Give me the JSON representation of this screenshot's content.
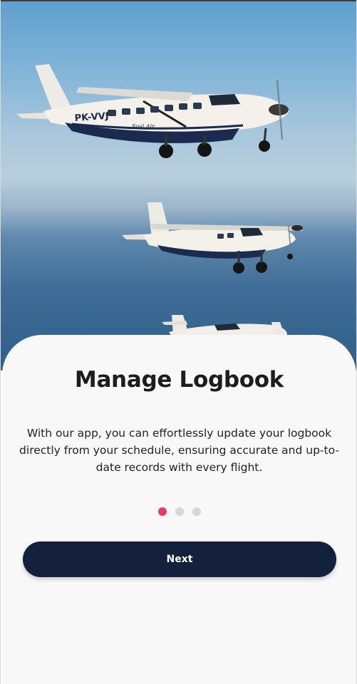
{
  "onboarding": {
    "title": "Manage Logbook",
    "description": "With our app, you can effortlessly update your logbook directly from your schedule, ensuring accurate and up-to-date records with every flight.",
    "pages": 3,
    "current_page": 1,
    "next_label": "Next"
  },
  "hero": {
    "plane_registration": "PK-VVJ",
    "plane_livery": "Susi Air"
  },
  "colors": {
    "accent_dot": "#e83a5a",
    "inactive_dot": "#d6d6d6",
    "button": "#14213d",
    "sheet": "#f8f8f8"
  }
}
